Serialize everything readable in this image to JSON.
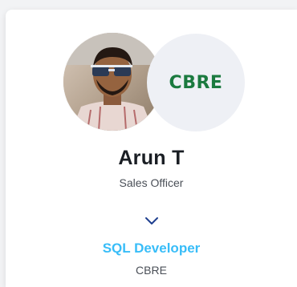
{
  "profile": {
    "name": "Arun T",
    "title": "Sales Officer",
    "avatar_icon": "person-photo"
  },
  "company": {
    "logo_text": "CBRE",
    "logo_color": "#1b7a3f",
    "name": "CBRE"
  },
  "experience": {
    "role": "SQL Developer",
    "role_color": "#38bdf8",
    "expand_icon": "chevron-down-icon"
  }
}
